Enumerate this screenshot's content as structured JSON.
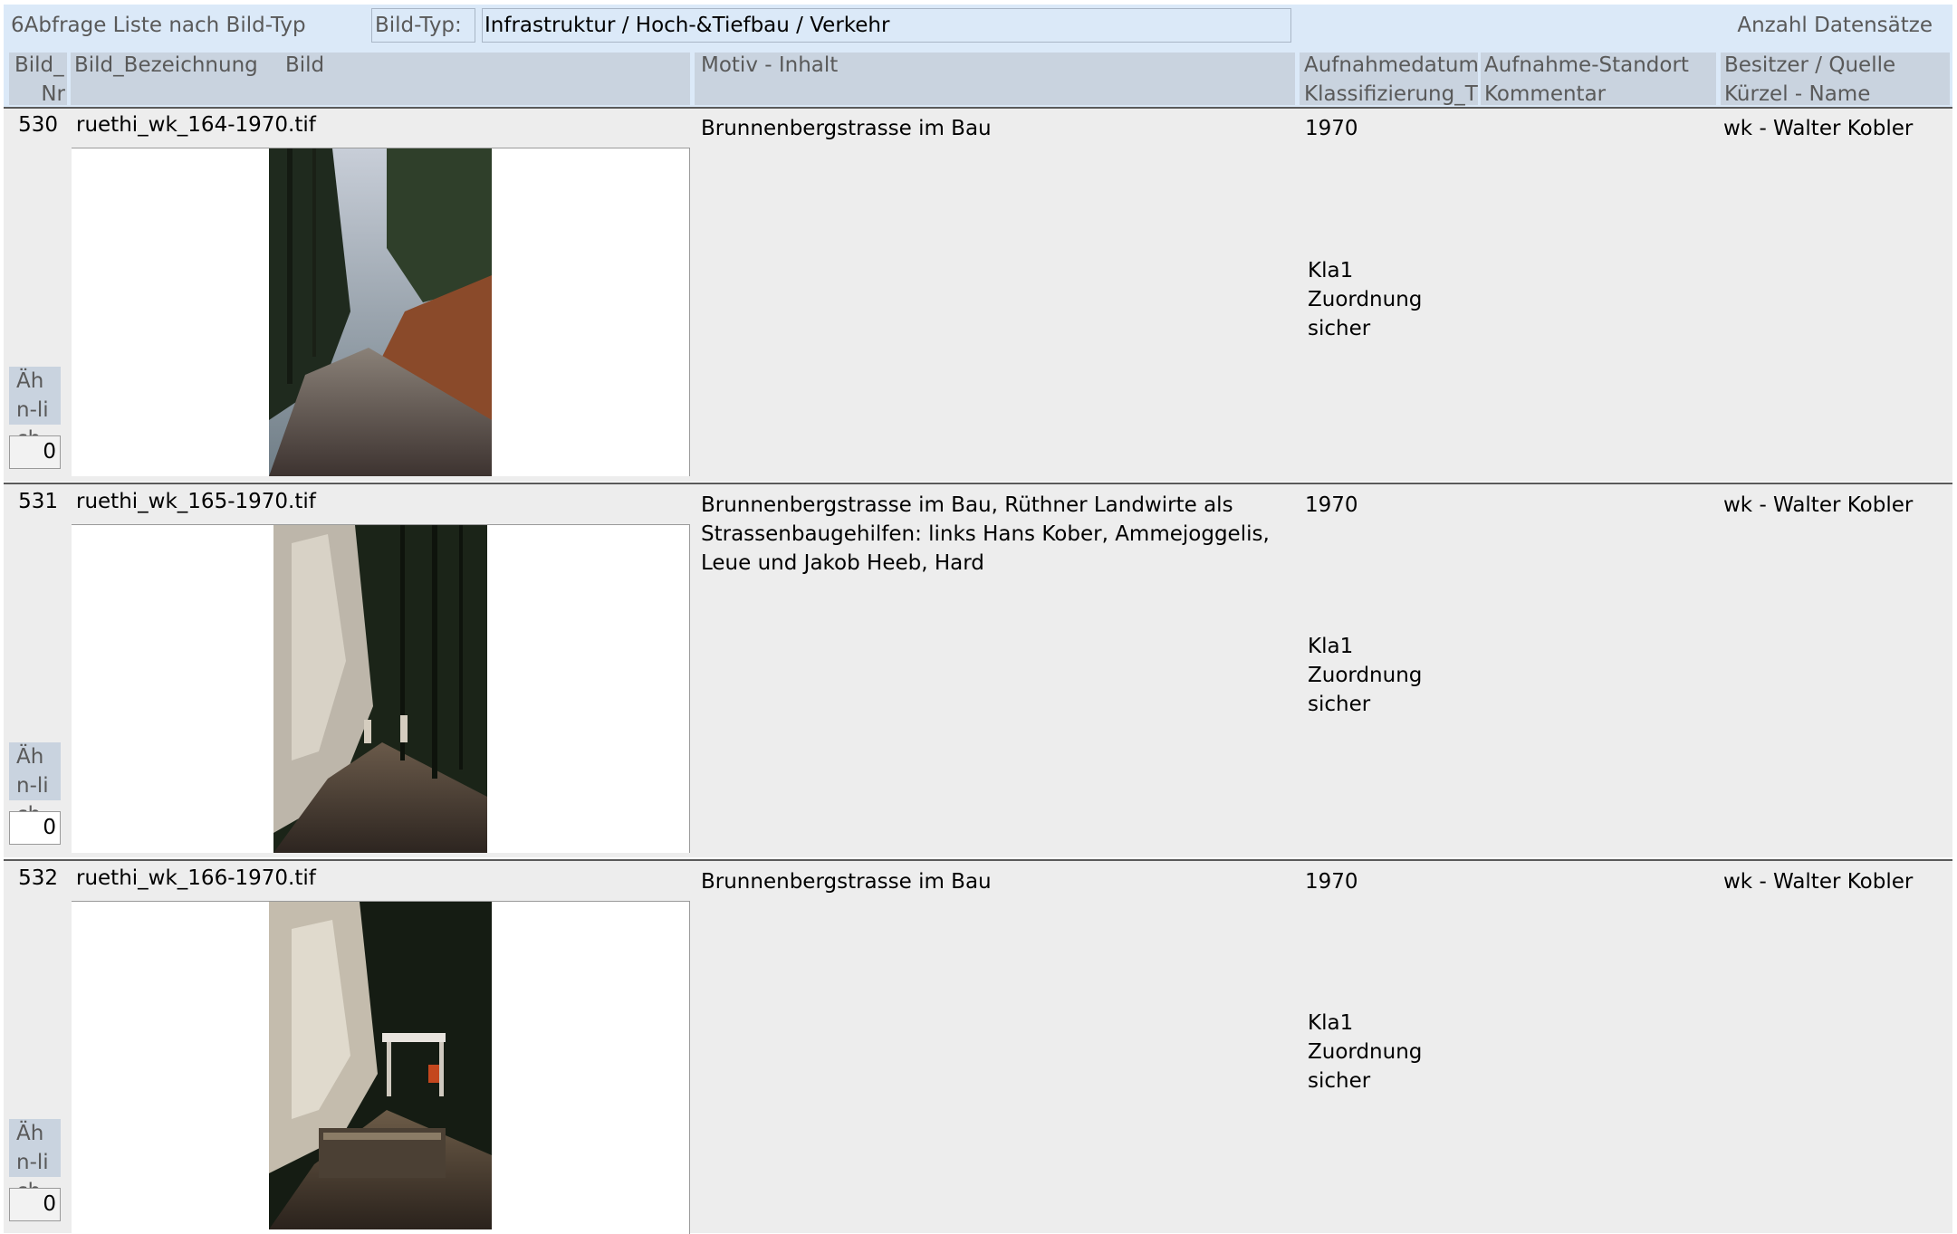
{
  "header": {
    "title": "6Abfrage Liste nach Bild-Typ",
    "filter_label": "Bild-Typ:",
    "filter_value": "Infrastruktur / Hoch-&Tiefbau / Verkehr",
    "count_label": "Anzahl Datensätze"
  },
  "columns": {
    "nr_line1": "Bild_",
    "nr_line2": "Nr",
    "bezeichnung": "Bild_Bezeichnung",
    "bild": "Bild",
    "motiv": "Motiv - Inhalt",
    "datum_line1": "Aufnahmedatum",
    "datum_line2": "Klassifizierung_T",
    "standort_line1": "Aufnahme-Standort",
    "standort_line2": "Kommentar",
    "besitzer_line1": "Besitzer / Quelle",
    "besitzer_line2": "Kürzel - Name"
  },
  "records": [
    {
      "nr": "530",
      "bezeichnung": "ruethi_wk_164-1970.tif",
      "motiv": "Brunnenbergstrasse im Bau",
      "datum": "1970",
      "klassifizierung": "Kla1 Zuordnung sicher",
      "besitzer": "wk - Walter Kobler",
      "aehnlich_label": "Ähn-lich",
      "aehnlich_value": "0"
    },
    {
      "nr": "531",
      "bezeichnung": "ruethi_wk_165-1970.tif",
      "motiv": "Brunnenbergstrasse im Bau, Rüthner Landwirte als Strassenbaugehilfen: links Hans Kober, Ammejoggelis, Leue und Jakob Heeb, Hard",
      "datum": "1970",
      "klassifizierung": "Kla1 Zuordnung sicher",
      "besitzer": "wk - Walter Kobler",
      "aehnlich_label": "Ähn-lich",
      "aehnlich_value": "0"
    },
    {
      "nr": "532",
      "bezeichnung": "ruethi_wk_166-1970.tif",
      "motiv": "Brunnenbergstrasse im Bau",
      "datum": "1970",
      "klassifizierung": "Kla1 Zuordnung sicher",
      "besitzer": "wk - Walter Kobler",
      "aehnlich_label": "Ähn-lich",
      "aehnlich_value": "0"
    }
  ]
}
